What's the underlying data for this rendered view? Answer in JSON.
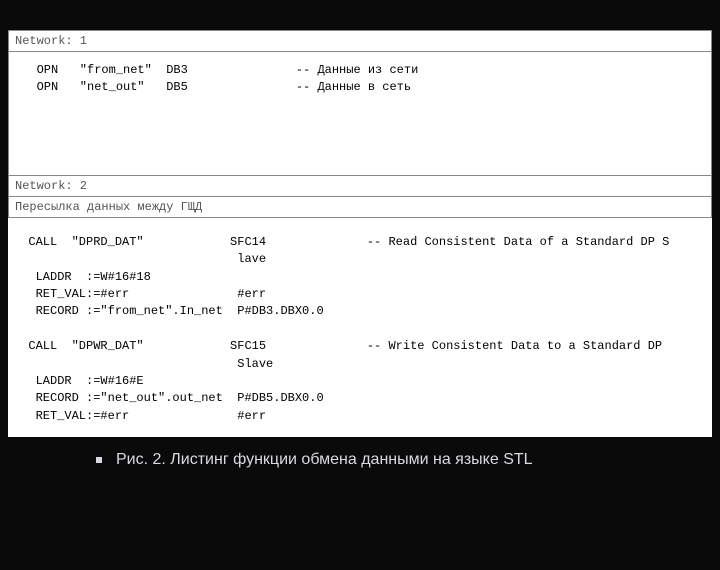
{
  "sheet1": {
    "header": "Network: 1",
    "code": "   OPN   \"from_net\"  DB3               -- Данные из сети\n   OPN   \"net_out\"   DB5               -- Данные в сеть"
  },
  "sheet2": {
    "header": "Network: 2",
    "subheader": "Пересылка данных между ГЩД",
    "code": "  CALL  \"DPRD_DAT\"            SFC14              -- Read Consistent Data of a Standard DP S\n                               lave\n   LADDR  :=W#16#18\n   RET_VAL:=#err               #err\n   RECORD :=\"from_net\".In_net  P#DB3.DBX0.0\n\n  CALL  \"DPWR_DAT\"            SFC15              -- Write Consistent Data to a Standard DP\n                               Slave\n   LADDR  :=W#16#E\n   RECORD :=\"net_out\".out_net  P#DB5.DBX0.0\n   RET_VAL:=#err               #err"
  },
  "caption": "Рис. 2. Листинг функции обмена данными на языке STL"
}
